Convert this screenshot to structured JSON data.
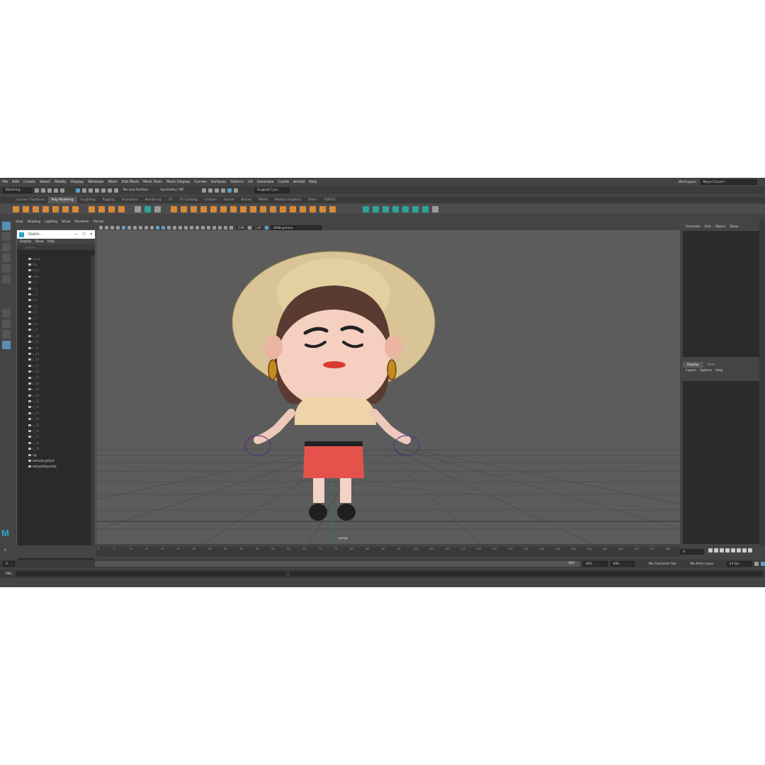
{
  "menubar": [
    "File",
    "Edit",
    "Create",
    "Select",
    "Modify",
    "Display",
    "Windows",
    "Mesh",
    "Edit Mesh",
    "Mesh Tools",
    "Mesh Display",
    "Curves",
    "Surfaces",
    "Deform",
    "UV",
    "Generate",
    "Cache",
    "Arnold",
    "Help"
  ],
  "workspace": {
    "label": "Workspace :",
    "value": "Maya Classic*"
  },
  "statusline": {
    "mode": "Modeling",
    "live_surface": "No Live Surface",
    "symmetry": "Symmetry: Off",
    "user": "Андрей Гурч"
  },
  "shelf_tabs": [
    "Curves / Surfaces",
    "Poly Modeling",
    "Sculpting",
    "Rigging",
    "Animation",
    "Rendering",
    "FX",
    "FX Caching",
    "Custom",
    "Arnold",
    "Bifrost",
    "MASH",
    "Motion Graphics",
    "XGen",
    "TURTLE"
  ],
  "shelf_active": "Poly Modeling",
  "viewport_menu": [
    "View",
    "Shading",
    "Lighting",
    "Show",
    "Renderer",
    "Panels"
  ],
  "viewport_tool": {
    "exposure": "0.00",
    "gamma": "1.00",
    "colorspace": "sRGB gamma"
  },
  "camera_label": "persp",
  "outliner": {
    "title": "Outlin...",
    "menu": [
      "Display",
      "Show",
      "Help"
    ],
    "search": "Search...",
    "items": [
      "persp",
      "top",
      "front",
      "side",
      "c_1",
      "c_2",
      "c_3",
      "c_4",
      "c_5",
      "c_6",
      "c_7",
      "c_8",
      "c_9",
      "c_10",
      "c_11",
      "c_12",
      "c_13",
      "c_14",
      "c_15",
      "c_16",
      "c_17",
      "c_18",
      "c_19",
      "c_20",
      "c_21",
      "c_22",
      "c_23",
      "c_24",
      "c_25",
      "c_26",
      "c_27",
      "c_28",
      "c_29",
      "rig",
      "defaultLightSet",
      "defaultObjectSet"
    ]
  },
  "channelbox": {
    "menu": [
      "Channels",
      "Edit",
      "Object",
      "Show"
    ],
    "tabs": [
      "Display",
      "Anim"
    ],
    "layer_menu": [
      "Layers",
      "Options",
      "Help"
    ]
  },
  "timeline": {
    "start": "0",
    "end": "600",
    "range_start": "600",
    "range_end": "600",
    "current": "0",
    "ticks": [
      "0",
      "5",
      "10",
      "15",
      "20",
      "25",
      "30",
      "35",
      "40",
      "45",
      "50",
      "55",
      "60",
      "65",
      "70",
      "75",
      "80",
      "85",
      "90",
      "95",
      "100",
      "105",
      "110",
      "115",
      "120",
      "125",
      "130",
      "135",
      "140",
      "145",
      "150",
      "155",
      "160",
      "165",
      "170",
      "175",
      "180"
    ]
  },
  "rangebar": {
    "char_set": "No Character Set",
    "anim_layer": "No Anim Layer",
    "fps": "24 fps"
  },
  "cmdline": {
    "label": "MEL"
  }
}
